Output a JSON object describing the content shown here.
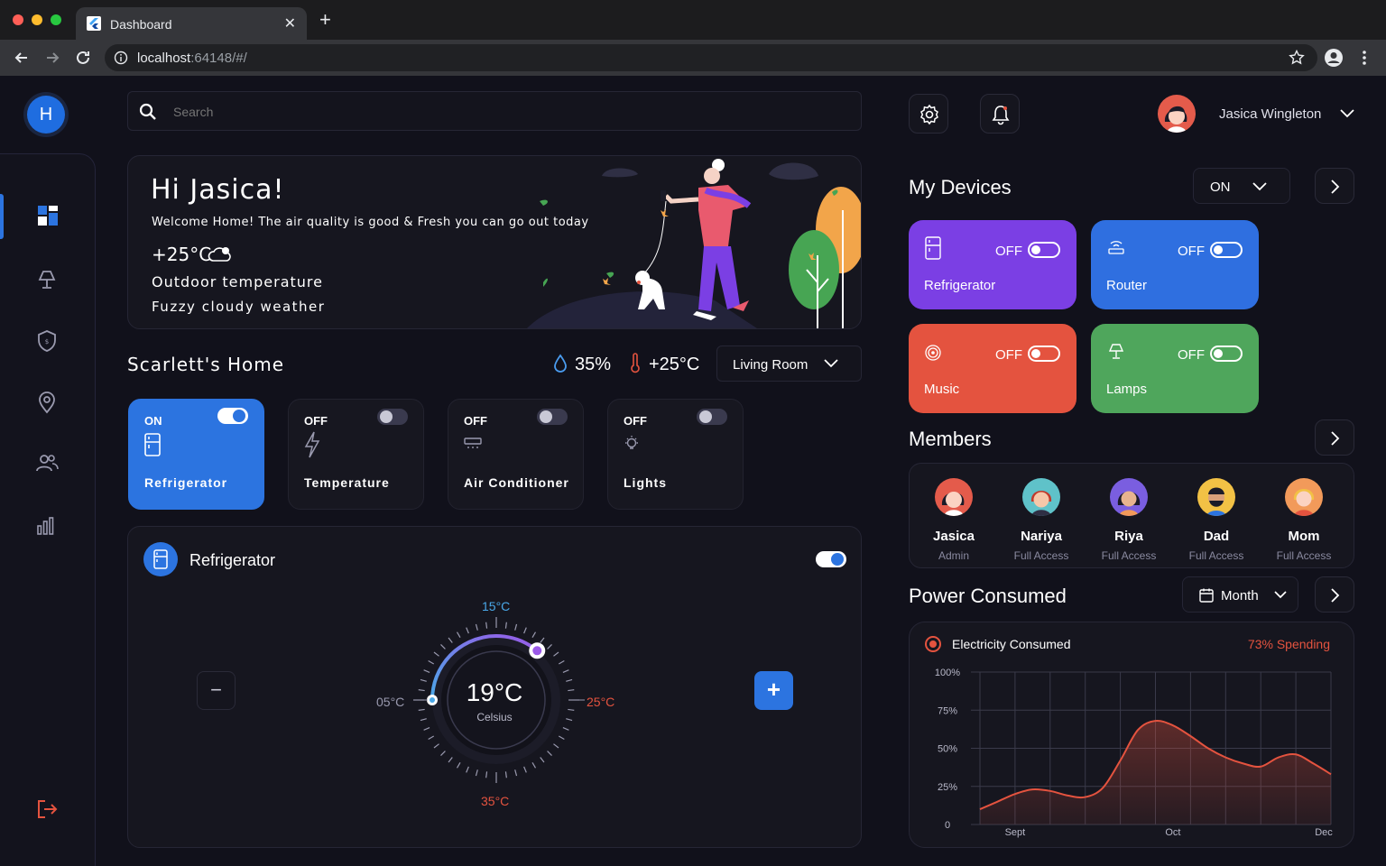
{
  "browser": {
    "tab_title": "Dashboard",
    "tab_close": "✕",
    "new_tab": "+",
    "url_host": "localhost",
    "url_rest": ":64148/#/"
  },
  "sidebar": {
    "logo_letter": "H",
    "items": [
      {
        "icon": "dashboard-icon",
        "active": true
      },
      {
        "icon": "lamp-icon"
      },
      {
        "icon": "shield-icon"
      },
      {
        "icon": "location-pin-icon"
      },
      {
        "icon": "users-icon"
      },
      {
        "icon": "bar-chart-icon"
      }
    ],
    "logout_icon": "logout-icon"
  },
  "search": {
    "placeholder": "Search"
  },
  "user": {
    "name": "Jasica Wingleton"
  },
  "welcome": {
    "greeting": "Hi Jasica!",
    "message": "Welcome Home! The air quality is good & Fresh you can go out today",
    "temp": "+25°C",
    "temp_label": "Outdoor temperature",
    "weather": "Fuzzy cloudy weather"
  },
  "home": {
    "title": "Scarlett's Home",
    "humidity": "35%",
    "temperature": "+25°C",
    "room": "Living Room",
    "controls": [
      {
        "status": "ON",
        "name": "Refrigerator",
        "on": true,
        "icon": "fridge-icon"
      },
      {
        "status": "OFF",
        "name": "Temperature",
        "on": false,
        "icon": "bolt-icon"
      },
      {
        "status": "OFF",
        "name": "Air Conditioner",
        "on": false,
        "icon": "ac-icon"
      },
      {
        "status": "OFF",
        "name": "Lights",
        "on": false,
        "icon": "bulb-icon"
      }
    ]
  },
  "thermostat": {
    "title": "Refrigerator",
    "on": true,
    "value": "19°C",
    "unit": "Celsius",
    "top": "15°C",
    "left": "05°C",
    "right": "25°C",
    "bottom": "35°C",
    "minus": "−",
    "plus": "+"
  },
  "devices": {
    "title": "My Devices",
    "filter": "ON",
    "items": [
      {
        "name": "Refrigerator",
        "status": "OFF",
        "color": "#7b3fe4",
        "icon": "fridge-icon"
      },
      {
        "name": "Router",
        "status": "OFF",
        "color": "#2f6fe0",
        "icon": "router-icon"
      },
      {
        "name": "Music",
        "status": "OFF",
        "color": "#e4533f",
        "icon": "music-icon"
      },
      {
        "name": "Lamps",
        "status": "OFF",
        "color": "#4fa65c",
        "icon": "lamp-icon"
      }
    ]
  },
  "members": {
    "title": "Members",
    "items": [
      {
        "name": "Jasica",
        "role": "Admin",
        "bg": "#e45b4b"
      },
      {
        "name": "Nariya",
        "role": "Full Access",
        "bg": "#5fc2c9"
      },
      {
        "name": "Riya",
        "role": "Full Access",
        "bg": "#7a5ee0"
      },
      {
        "name": "Dad",
        "role": "Full Access",
        "bg": "#f2c145"
      },
      {
        "name": "Mom",
        "role": "Full Access",
        "bg": "#f29a5a"
      }
    ]
  },
  "power": {
    "title": "Power Consumed",
    "period": "Month",
    "legend": "Electricity Consumed",
    "spending": "73% Spending"
  },
  "chart_data": {
    "type": "area",
    "series": [
      {
        "name": "Electricity Consumed",
        "color": "#e4533f",
        "x": [
          0,
          1,
          2,
          3,
          4,
          5,
          6,
          7,
          8,
          9,
          10,
          11,
          12,
          13,
          14,
          15,
          16,
          17,
          18,
          19,
          20
        ],
        "values": [
          10,
          15,
          20,
          23,
          22,
          19,
          18,
          24,
          42,
          62,
          68,
          65,
          58,
          50,
          44,
          40,
          38,
          44,
          46,
          40,
          33
        ]
      }
    ],
    "x_tick_labels": [
      {
        "at": 2,
        "label": "Sept"
      },
      {
        "at": 11,
        "label": "Oct"
      },
      {
        "at": 20,
        "label": "Dec"
      }
    ],
    "y_tick_labels": [
      "0",
      "25%",
      "50%",
      "75%",
      "100%"
    ],
    "ylim": [
      0,
      100
    ],
    "xlim": [
      0,
      20
    ],
    "grid": true
  }
}
